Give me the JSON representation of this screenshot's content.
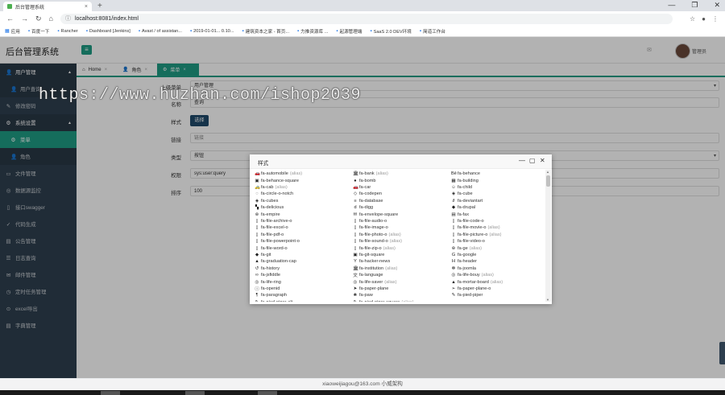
{
  "browser": {
    "tab_title": "后台管理系统",
    "url": "localhost:8081/index.html",
    "bookmarks": [
      "应用",
      "百度一下",
      "Rancher",
      "Dashboard [Jenkins]",
      "Avast / of assistan...",
      "2019-01-01... 0.10...",
      "建筑资本之家 - 首页...",
      "力推资源库 ...",
      "起源管理端",
      "SaaS 2.0 DEV环境",
      "简道工作台"
    ]
  },
  "header": {
    "app_title": "后台管理系统",
    "menu_toggle_icon": "bars-icon",
    "username": "管理员"
  },
  "sidebar": {
    "items": [
      {
        "label": "用户管理",
        "icon": "user-icon",
        "type": "parent"
      },
      {
        "label": "用户查询",
        "icon": "user-icon",
        "type": "child"
      },
      {
        "label": "修改密码",
        "icon": "edit-icon",
        "type": "top"
      },
      {
        "label": "系统设置",
        "icon": "gear-icon",
        "type": "parent"
      },
      {
        "label": "菜单",
        "icon": "gear-icon",
        "type": "active"
      },
      {
        "label": "角色",
        "icon": "user-icon",
        "type": "child"
      },
      {
        "label": "文件管理",
        "icon": "folder-icon",
        "type": "top"
      },
      {
        "label": "数据源监控",
        "icon": "database-icon",
        "type": "top"
      },
      {
        "label": "接口swagger",
        "icon": "file-icon",
        "type": "top"
      },
      {
        "label": "代码生成",
        "icon": "wrench-icon",
        "type": "top"
      },
      {
        "label": "公告管理",
        "icon": "book-icon",
        "type": "top"
      },
      {
        "label": "日志查询",
        "icon": "list-icon",
        "type": "top"
      },
      {
        "label": "邮件管理",
        "icon": "envelope-icon",
        "type": "top"
      },
      {
        "label": "定时任务管理",
        "icon": "clock-icon",
        "type": "top"
      },
      {
        "label": "excel导出",
        "icon": "table-icon",
        "type": "top"
      },
      {
        "label": "字典管理",
        "icon": "book-icon",
        "type": "top"
      }
    ]
  },
  "page_tabs": [
    {
      "label": "Home",
      "active": false
    },
    {
      "label": "角色",
      "active": false
    },
    {
      "label": "菜单",
      "active": true
    }
  ],
  "form": {
    "parent_label": "上级菜单",
    "parent_value": "用户管理",
    "name_label": "名称",
    "name_value": "查询",
    "style_label": "样式",
    "style_button": "选择",
    "link_label": "链接",
    "link_placeholder": "链接",
    "type_label": "类型",
    "type_value": "按钮",
    "perm_label": "权限",
    "perm_value": "sys:user:query",
    "sort_label": "排序",
    "sort_value": "100"
  },
  "watermark": "https://www.huzhan.com/ishop2039",
  "modal": {
    "title": "样式",
    "minimize_icon": "minimize-icon",
    "maximize_icon": "maximize-icon",
    "close_icon": "close-icon",
    "alias_label": "(alias)",
    "icons": [
      {
        "n": "fa-automobile",
        "a": true,
        "g": "🚗"
      },
      {
        "n": "fa-bank",
        "a": true,
        "g": "🏛"
      },
      {
        "n": "fa-behance",
        "a": false,
        "g": "Bē"
      },
      {
        "n": "fa-behance-square",
        "a": false,
        "g": "▣"
      },
      {
        "n": "fa-bomb",
        "a": false,
        "g": "●"
      },
      {
        "n": "fa-building",
        "a": false,
        "g": "▦"
      },
      {
        "n": "fa-cab",
        "a": true,
        "g": "🚕"
      },
      {
        "n": "fa-car",
        "a": false,
        "g": "🚗"
      },
      {
        "n": "fa-child",
        "a": false,
        "g": "☺"
      },
      {
        "n": "fa-circle-o-notch",
        "a": false,
        "g": "◌"
      },
      {
        "n": "fa-codepen",
        "a": false,
        "g": "◇"
      },
      {
        "n": "fa-cube",
        "a": false,
        "g": "◈"
      },
      {
        "n": "fa-cubes",
        "a": false,
        "g": "◈"
      },
      {
        "n": "fa-database",
        "a": false,
        "g": "≡"
      },
      {
        "n": "fa-deviantart",
        "a": false,
        "g": "∂"
      },
      {
        "n": "fa-delicious",
        "a": false,
        "g": "▚"
      },
      {
        "n": "fa-digg",
        "a": false,
        "g": "d"
      },
      {
        "n": "fa-drupal",
        "a": false,
        "g": "◆"
      },
      {
        "n": "fa-empire",
        "a": false,
        "g": "⊛"
      },
      {
        "n": "fa-envelope-square",
        "a": false,
        "g": "✉"
      },
      {
        "n": "fa-fax",
        "a": false,
        "g": "▤"
      },
      {
        "n": "fa-file-archive-o",
        "a": false,
        "g": "▯"
      },
      {
        "n": "fa-file-audio-o",
        "a": false,
        "g": "▯"
      },
      {
        "n": "fa-file-code-o",
        "a": false,
        "g": "▯"
      },
      {
        "n": "fa-file-excel-o",
        "a": false,
        "g": "▯"
      },
      {
        "n": "fa-file-image-o",
        "a": false,
        "g": "▯"
      },
      {
        "n": "fa-file-movie-o",
        "a": true,
        "g": "▯"
      },
      {
        "n": "fa-file-pdf-o",
        "a": false,
        "g": "▯"
      },
      {
        "n": "fa-file-photo-o",
        "a": true,
        "g": "▯"
      },
      {
        "n": "fa-file-picture-o",
        "a": true,
        "g": "▯"
      },
      {
        "n": "fa-file-powerpoint-o",
        "a": false,
        "g": "▯"
      },
      {
        "n": "fa-file-sound-o",
        "a": true,
        "g": "▯"
      },
      {
        "n": "fa-file-video-o",
        "a": false,
        "g": "▯"
      },
      {
        "n": "fa-file-word-o",
        "a": false,
        "g": "▯"
      },
      {
        "n": "fa-file-zip-o",
        "a": true,
        "g": "▯"
      },
      {
        "n": "fa-ge",
        "a": true,
        "g": "⊛"
      },
      {
        "n": "fa-git",
        "a": false,
        "g": "◆"
      },
      {
        "n": "fa-git-square",
        "a": false,
        "g": "▣"
      },
      {
        "n": "fa-google",
        "a": false,
        "g": "G"
      },
      {
        "n": "fa-graduation-cap",
        "a": false,
        "g": "▲"
      },
      {
        "n": "fa-hacker-news",
        "a": false,
        "g": "Y"
      },
      {
        "n": "fa-header",
        "a": false,
        "g": "H"
      },
      {
        "n": "fa-history",
        "a": false,
        "g": "↺"
      },
      {
        "n": "fa-institution",
        "a": true,
        "g": "🏛"
      },
      {
        "n": "fa-joomla",
        "a": false,
        "g": "✻"
      },
      {
        "n": "fa-jsfiddle",
        "a": false,
        "g": "∞"
      },
      {
        "n": "fa-language",
        "a": false,
        "g": "文"
      },
      {
        "n": "fa-life-bouy",
        "a": true,
        "g": "◎"
      },
      {
        "n": "fa-life-ring",
        "a": false,
        "g": "◎"
      },
      {
        "n": "fa-life-saver",
        "a": true,
        "g": "◎"
      },
      {
        "n": "fa-mortar-board",
        "a": true,
        "g": "▲"
      },
      {
        "n": "fa-openid",
        "a": false,
        "g": "ⓘ"
      },
      {
        "n": "fa-paper-plane",
        "a": false,
        "g": "➤"
      },
      {
        "n": "fa-paper-plane-o",
        "a": false,
        "g": "➢"
      },
      {
        "n": "fa-paragraph",
        "a": false,
        "g": "¶"
      },
      {
        "n": "fa-paw",
        "a": false,
        "g": "❀"
      },
      {
        "n": "fa-pied-piper",
        "a": false,
        "g": "✎"
      },
      {
        "n": "fa-pied-piper-alt",
        "a": false,
        "g": "✎"
      },
      {
        "n": "fa-pied-piper-square",
        "a": true,
        "g": "✎"
      }
    ]
  },
  "footer": {
    "text": "xiaoweijiagou@163.com 小威架构"
  }
}
